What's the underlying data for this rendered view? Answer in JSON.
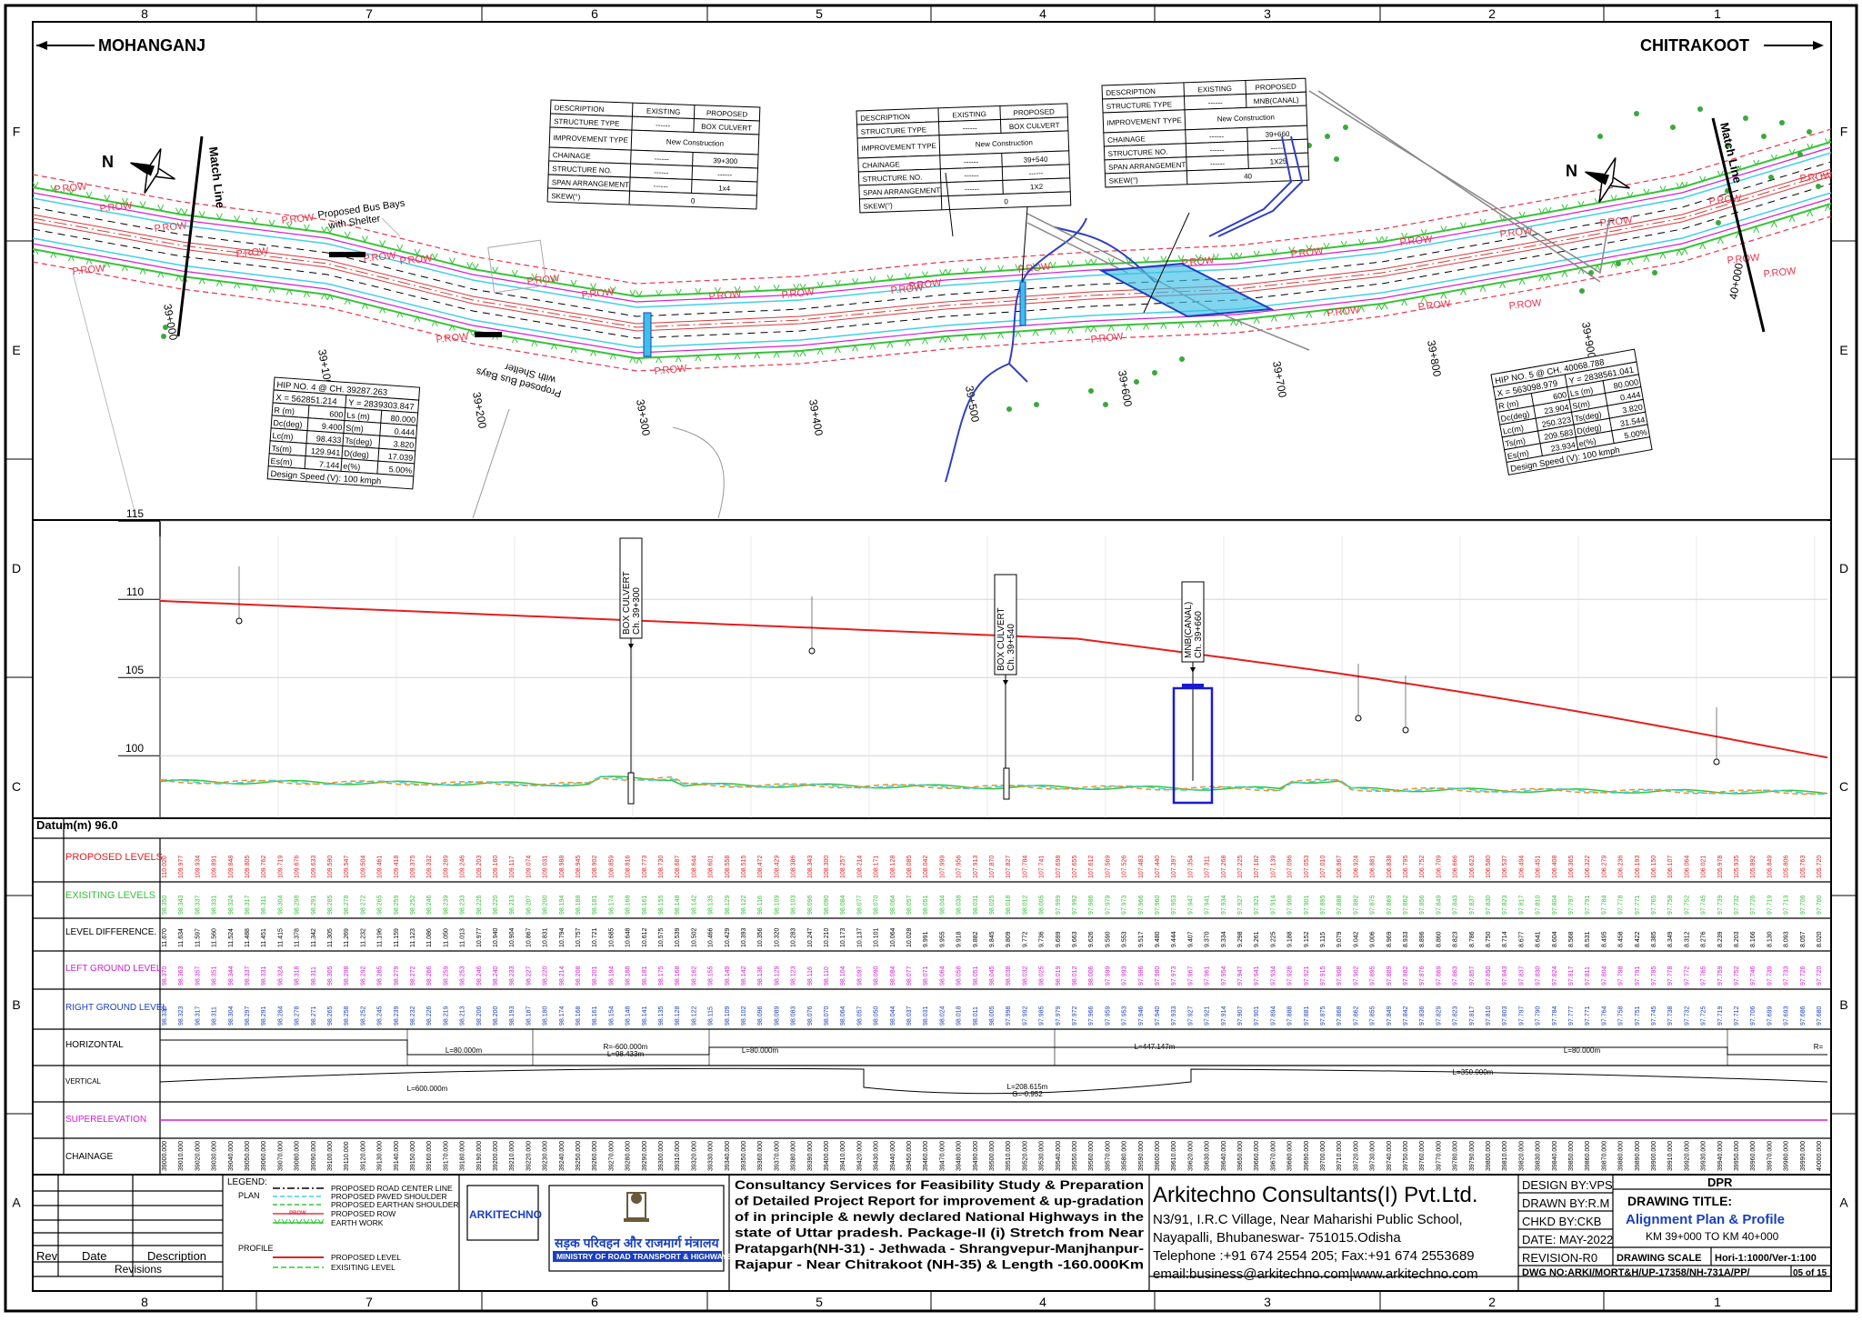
{
  "grid": {
    "cols": [
      "8",
      "7",
      "6",
      "5",
      "4",
      "3",
      "2",
      "1"
    ],
    "rows": [
      "F",
      "E",
      "D",
      "C",
      "B",
      "A"
    ]
  },
  "plan": {
    "left_place": "MOHANGANJ",
    "right_place": "CHITRAKOOT",
    "row_label": "P.ROW",
    "match_line": "Match Line",
    "north": "N",
    "bus_bay_top": "Proposed Bus Bays with Shelter",
    "bus_bay_bottom": "Proposed Bus Bays with Shelter",
    "chainages": [
      "39+000",
      "39+100",
      "39+200",
      "39+300",
      "39+400",
      "39+500",
      "39+600",
      "39+700",
      "39+800",
      "39+900",
      "40+000"
    ]
  },
  "structures": [
    {
      "rows": [
        [
          "DESCRIPTION",
          "EXISTING",
          "PROPOSED"
        ],
        [
          "STRUCTURE TYPE",
          "------",
          "BOX CULVERT"
        ],
        [
          "IMPROVEMENT TYPE",
          "New Construction",
          ""
        ],
        [
          "CHAINAGE",
          "------",
          "39+300"
        ],
        [
          "STRUCTURE NO.",
          "------",
          "------"
        ],
        [
          "SPAN ARRANGEMENT",
          "------",
          "1x4"
        ],
        [
          "SKEW(°)",
          "0",
          ""
        ]
      ]
    },
    {
      "rows": [
        [
          "DESCRIPTION",
          "EXISTING",
          "PROPOSED"
        ],
        [
          "STRUCTURE TYPE",
          "------",
          "BOX CULVERT"
        ],
        [
          "IMPROVEMENT TYPE",
          "New Construction",
          ""
        ],
        [
          "CHAINAGE",
          "------",
          "39+540"
        ],
        [
          "STRUCTURE NO.",
          "------",
          "------"
        ],
        [
          "SPAN ARRANGEMENT",
          "------",
          "1X2"
        ],
        [
          "SKEW(°)",
          "0",
          ""
        ]
      ]
    },
    {
      "rows": [
        [
          "DESCRIPTION",
          "EXISTING",
          "PROPOSED"
        ],
        [
          "STRUCTURE TYPE",
          "------",
          "MNB(CANAL)"
        ],
        [
          "IMPROVEMENT TYPE",
          "New Construction",
          ""
        ],
        [
          "CHAINAGE",
          "------",
          "39+660"
        ],
        [
          "STRUCTURE NO.",
          "------",
          "------"
        ],
        [
          "SPAN ARRANGEMENT",
          "------",
          "1X25"
        ],
        [
          "SKEW(°)",
          "40",
          ""
        ]
      ]
    }
  ],
  "hip4": {
    "title": "HIP NO. 4 @ CH. 39287.263",
    "xy": [
      "X = 562851.214",
      "Y = 2839303.847"
    ],
    "rows": [
      [
        "R (m)",
        "600",
        "Ls (m)",
        "80.000"
      ],
      [
        "Dc(deg)",
        "9.400",
        "S(m)",
        "0.444"
      ],
      [
        "Lc(m)",
        "98.433",
        "Ts(deg)",
        "3.820"
      ],
      [
        "Ts(m)",
        "129.941",
        "D(deg)",
        "17.039"
      ],
      [
        "Es(m)",
        "7.144",
        "e(%)",
        "5.00%"
      ]
    ],
    "speed": "Design Speed (V): 100 kmph"
  },
  "hip5": {
    "title": "HIP NO. 5 @ CH. 40068.788",
    "xy": [
      "X = 563098.979",
      "Y = 2838561.041"
    ],
    "rows": [
      [
        "R (m)",
        "600",
        "Ls (m)",
        "80.000"
      ],
      [
        "Dc(deg)",
        "23.904",
        "S(m)",
        "0.444"
      ],
      [
        "Lc(m)",
        "250.323",
        "Ts(deg)",
        "3.820"
      ],
      [
        "Ts(m)",
        "209.583",
        "D(deg)",
        "31.544"
      ],
      [
        "Es(m)",
        "23.934",
        "e(%)",
        "5.00%"
      ]
    ],
    "speed": "Design Speed (V): 100 kmph"
  },
  "profile": {
    "datum": "Datum(m) 96.0",
    "y_ticks": [
      "115",
      "110",
      "105",
      "100"
    ],
    "callouts": [
      "BOX CULVERT Ch. 39+300",
      "BOX CULVERT Ch. 39+540",
      "MNB(CANAL) Ch. 39+660"
    ]
  },
  "band_labels": {
    "proposed": "PROPOSED LEVELS",
    "existing": "EXISITING LEVELS",
    "difference": "LEVEL DIFFERENCE.",
    "left_ground": "LEFT GROUND LEVEL",
    "right_ground": "RIGHT GROUND LEVEL",
    "horizontal": "HORIZONTAL",
    "vertical": "VERTICAL",
    "superelevation": "SUPERELEVATION",
    "chainage": "CHAINAGE"
  },
  "horizontal_marks": [
    "L=80.000m",
    "R=-600.000m",
    "L=98.433m",
    "L=80.000m",
    "L=447.147m",
    "L=80.000m",
    "R="
  ],
  "vertical_marks": [
    "L=600.000m",
    "L=208.615m",
    "G=-0.952",
    "L=350.000m"
  ],
  "title_block": {
    "revisions": {
      "rev": "Rev",
      "date": "Date",
      "description": "Description",
      "caption": "Revisions"
    },
    "legend": {
      "title": "LEGEND:",
      "plan": "PLAN",
      "profile": "PROFILE",
      "items": [
        "PROPOSED ROAD CENTER LINE",
        "PROPOSED PAVED SHOULDER",
        "PROPOSED EARTHAN SHOULDER",
        "PROPOSED ROW",
        "EARTH WORK"
      ],
      "profile_items": [
        "PROPOSED LEVEL",
        "EXISITING LEVEL"
      ],
      "prow_tag": "PROW"
    },
    "logo1": "ARKITECHNO",
    "ministry_hindi": "सड़क परिवहन और राजमार्ग मंत्रालय",
    "ministry": "MINISTRY OF ROAD TRANSPORT & HIGHWAYS",
    "project_lines": [
      "Consultancy Services for Feasibility Study & Preparation",
      "of Detailed Project Report for improvement & up-gradation",
      "of in principle & newly declared National Highways in the",
      "state of Uttar pradesh. Package-II (i) Stretch from Near",
      "Pratapgarh(NH-31) - Jethwada - Shrangvepur-Manjhanpur-",
      "Rajapur - Near Chitrakoot (NH-35) & Length -160.000Km"
    ],
    "company": "Arkitechno Consultants(I) Pvt.Ltd.",
    "address1": "N3/91, I.R.C Village, Near Maharishi Public School,",
    "address2": "Nayapalli, Bhubaneswar- 751015.Odisha",
    "phone": "Telephone :+91 674 2554 205; Fax:+91 674 2553689",
    "email": "email:business@arkitechno.com|www.arkitechno.com",
    "design_by": "DESIGN BY:VPS",
    "drawn_by": "DRAWN BY:R.M",
    "chkd_by": "CHKD BY:CKB",
    "date": "DATE: MAY-2022",
    "revision": "REVISION-R0",
    "dpr": "DPR",
    "drawing_title_label": "DRAWING TITLE:",
    "drawing_title": "Alignment Plan & Profile",
    "km_range": "KM 39+000 TO KM 40+000",
    "scale_label": "DRAWING SCALE",
    "scale": "Hori-1:1000/Ver-1:100",
    "dwg_no": "DWG NO:ARKI/MORT&H/UP-17358/NH-731A/PP/",
    "sheet_no": "05 of 15"
  },
  "colors": {
    "row_line": "#e8344a",
    "center_line": "#d23a3a",
    "paved": "#3fd0e6",
    "earthen": "#37c23a",
    "magenta": "#d020d0",
    "proposed_profile": "#e51e1e",
    "title_blue": "#1a3fbf"
  }
}
